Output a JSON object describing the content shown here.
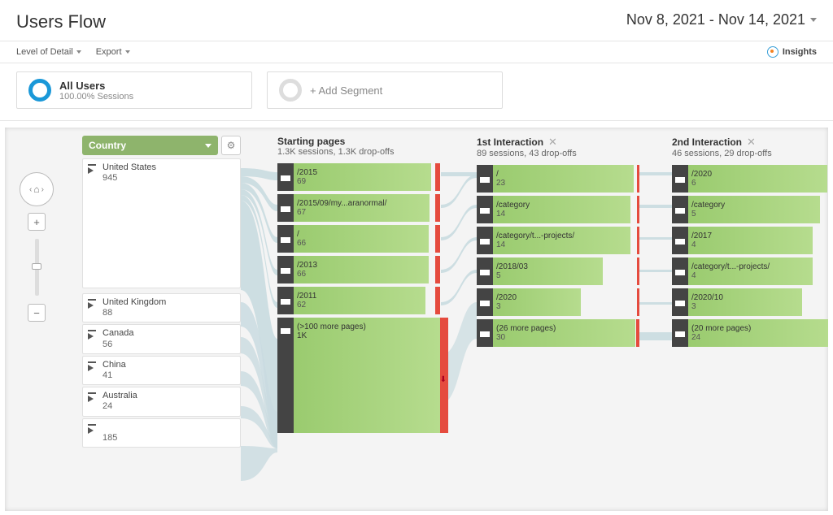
{
  "title": "Users Flow",
  "date_range": "Nov 8, 2021 - Nov 14, 2021",
  "toolbar": {
    "level_of_detail": "Level of Detail",
    "export": "Export",
    "insights": "Insights"
  },
  "segments": {
    "all_users": {
      "name": "All Users",
      "desc": "100.00% Sessions"
    },
    "add": "+ Add Segment"
  },
  "dimension": "Country",
  "nav": {
    "plus": "+",
    "minus": "−"
  },
  "sources": [
    {
      "label": "United States",
      "value": "945"
    },
    {
      "label": "United Kingdom",
      "value": "88"
    },
    {
      "label": "Canada",
      "value": "56"
    },
    {
      "label": "China",
      "value": "41"
    },
    {
      "label": "Australia",
      "value": "24"
    },
    {
      "label": "",
      "value": "185"
    }
  ],
  "columns": [
    {
      "title": "Starting pages",
      "sub": "1.3K sessions, 1.3K drop-offs",
      "nodes": [
        {
          "label": "/2015",
          "value": "69",
          "width": 94,
          "drop": 6
        },
        {
          "label": "/2015/09/my...aranormal/",
          "value": "67",
          "width": 93,
          "drop": 6
        },
        {
          "label": "/",
          "value": "66",
          "width": 92,
          "drop": 6
        },
        {
          "label": "/2013",
          "value": "66",
          "width": 92,
          "drop": 6
        },
        {
          "label": "/2011",
          "value": "62",
          "width": 90,
          "drop": 6
        }
      ],
      "more": {
        "label": "(>100 more pages)",
        "value": "1K"
      }
    },
    {
      "title": "1st Interaction",
      "sub": "89 sessions, 43 drop-offs",
      "nodes": [
        {
          "label": "/",
          "value": "23",
          "width": 96,
          "drop": 3
        },
        {
          "label": "/category",
          "value": "14",
          "width": 94,
          "drop": 3
        },
        {
          "label": "/category/t...-projects/",
          "value": "14",
          "width": 94,
          "drop": 3
        },
        {
          "label": "/2018/03",
          "value": "5",
          "width": 75,
          "drop": 3
        },
        {
          "label": "/2020",
          "value": "3",
          "width": 60,
          "drop": 3
        },
        {
          "label": "(26 more pages)",
          "value": "30",
          "width": 97,
          "drop": 4
        }
      ]
    },
    {
      "title": "2nd Interaction",
      "sub": "46 sessions, 29 drop-offs",
      "nodes": [
        {
          "label": "/2020",
          "value": "6",
          "width": 95,
          "drop": 3
        },
        {
          "label": "/category",
          "value": "5",
          "width": 90,
          "drop": 3
        },
        {
          "label": "/2017",
          "value": "4",
          "width": 85,
          "drop": 3
        },
        {
          "label": "/category/t...-projects/",
          "value": "4",
          "width": 85,
          "drop": 3
        },
        {
          "label": "/2020/10",
          "value": "3",
          "width": 78,
          "drop": 3
        },
        {
          "label": "(20 more pages)",
          "value": "24",
          "width": 98,
          "drop": 5
        }
      ]
    }
  ]
}
